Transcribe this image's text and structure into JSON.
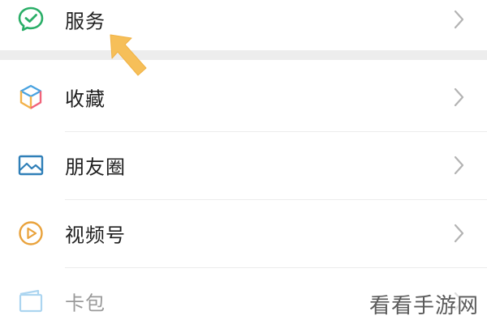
{
  "menu": {
    "items": [
      {
        "label": "服务",
        "icon": "service-check-icon",
        "icon_color": "#2aae67"
      },
      {
        "label": "收藏",
        "icon": "favorites-cube-icon",
        "icon_colors": [
          "#4aa3e0",
          "#f3b24a",
          "#f1637a"
        ]
      },
      {
        "label": "朋友圈",
        "icon": "moments-picture-icon",
        "icon_color": "#2f7fb8"
      },
      {
        "label": "视频号",
        "icon": "channels-play-icon",
        "icon_color": "#e9a23b"
      },
      {
        "label": "卡包",
        "icon": "card-wallet-icon",
        "icon_color": "#4aa3e0"
      }
    ]
  },
  "annotation": {
    "arrow_color": "#f6bf59"
  },
  "watermark": {
    "text": "看看手游网"
  }
}
